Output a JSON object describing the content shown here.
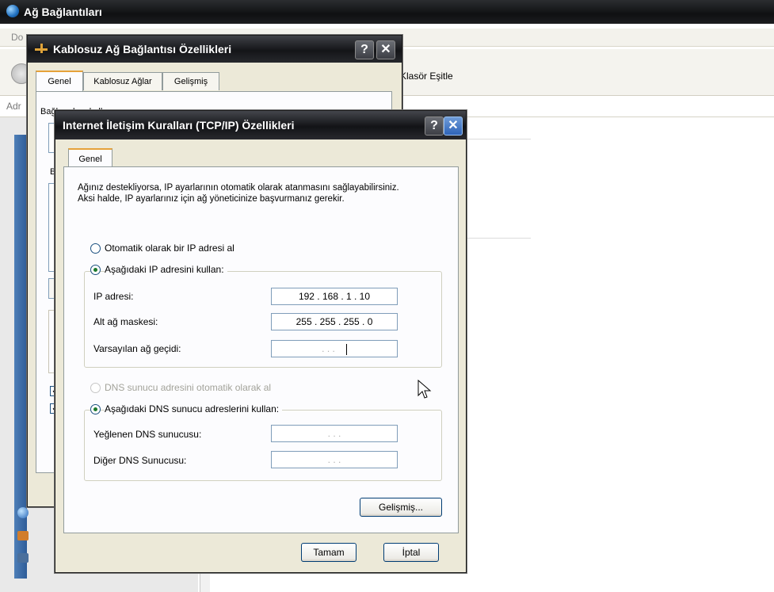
{
  "background_window": {
    "title": "Ağ Bağlantıları",
    "menu_fragment": "Do",
    "toolbar_fragment": "Klasör Eşitle",
    "address_fragment": "Adr"
  },
  "back_dialog": {
    "title": "Kablosuz Ağ Bağlantısı Özellikleri",
    "help_label": "?",
    "close_label": "✕",
    "tabs": [
      "Genel",
      "Kablosuz Ağlar",
      "Gelişmiş"
    ],
    "frag_label_1": "Bağlanırken kullan:",
    "frag_label_2": "B"
  },
  "dialog": {
    "title": "Internet İletişim Kuralları (TCP/IP) Özellikleri",
    "help_label": "?",
    "close_label": "✕",
    "tab": "Genel",
    "description": "Ağınız destekliyorsa, IP ayarlarının otomatik olarak atanmasını sağlayabilirsiniz. Aksi halde, IP ayarlarınız için ağ yöneticinize başvurmanız gerekir.",
    "ip_mode": {
      "auto_label": "Otomatik olarak bir IP adresi al",
      "manual_label": "Aşağıdaki IP adresini kullan:",
      "selected": "manual"
    },
    "ip_address_label": "IP adresi:",
    "ip_address_value": "192 . 168 .  1  .  10",
    "subnet_label": "Alt ağ maskesi:",
    "subnet_value": "255 . 255 . 255 .  0",
    "gateway_label": "Varsayılan ağ geçidi:",
    "gateway_value": ".        .        .",
    "dns_mode": {
      "auto_label": "DNS sunucu adresini otomatik olarak al",
      "manual_label": "Aşağıdaki DNS sunucu adreslerini kullan:",
      "selected": "manual"
    },
    "preferred_dns_label": "Yeğlenen DNS sunucusu:",
    "preferred_dns_value": ".        .        .",
    "alternate_dns_label": "Diğer DNS Sunucusu:",
    "alternate_dns_value": ".        .        .",
    "advanced_button": "Gelişmiş...",
    "ok_button": "Tamam",
    "cancel_button": "İptal"
  },
  "icons": {
    "app": "network-connections-icon",
    "dialog": "network-adapter-icon",
    "cursor": "mouse-pointer-icon"
  }
}
